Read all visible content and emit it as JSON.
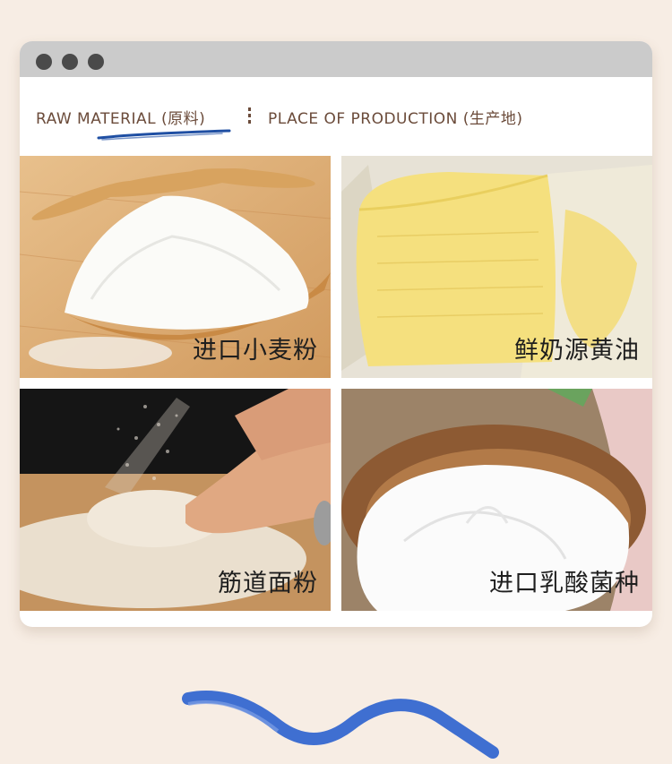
{
  "tabs": [
    {
      "label": "RAW MATERIAL (原料)"
    },
    {
      "label": "PLACE OF PRODUCTION (生产地)"
    }
  ],
  "ingredients": [
    {
      "caption": "进口小麦粉",
      "image": "flour-on-wooden-spoon"
    },
    {
      "caption": "鲜奶源黄油",
      "image": "butter-block"
    },
    {
      "caption": "筋道面粉",
      "image": "kneading-dough"
    },
    {
      "caption": "进口乳酸菌种",
      "image": "yogurt-in-wooden-bowl"
    }
  ],
  "colors": {
    "background": "#f7ede4",
    "titlebar": "#cbcbcb",
    "tab_text": "#6b4b3a",
    "underline": "#1f4fa3",
    "ribbon": "#3f6fd1"
  }
}
